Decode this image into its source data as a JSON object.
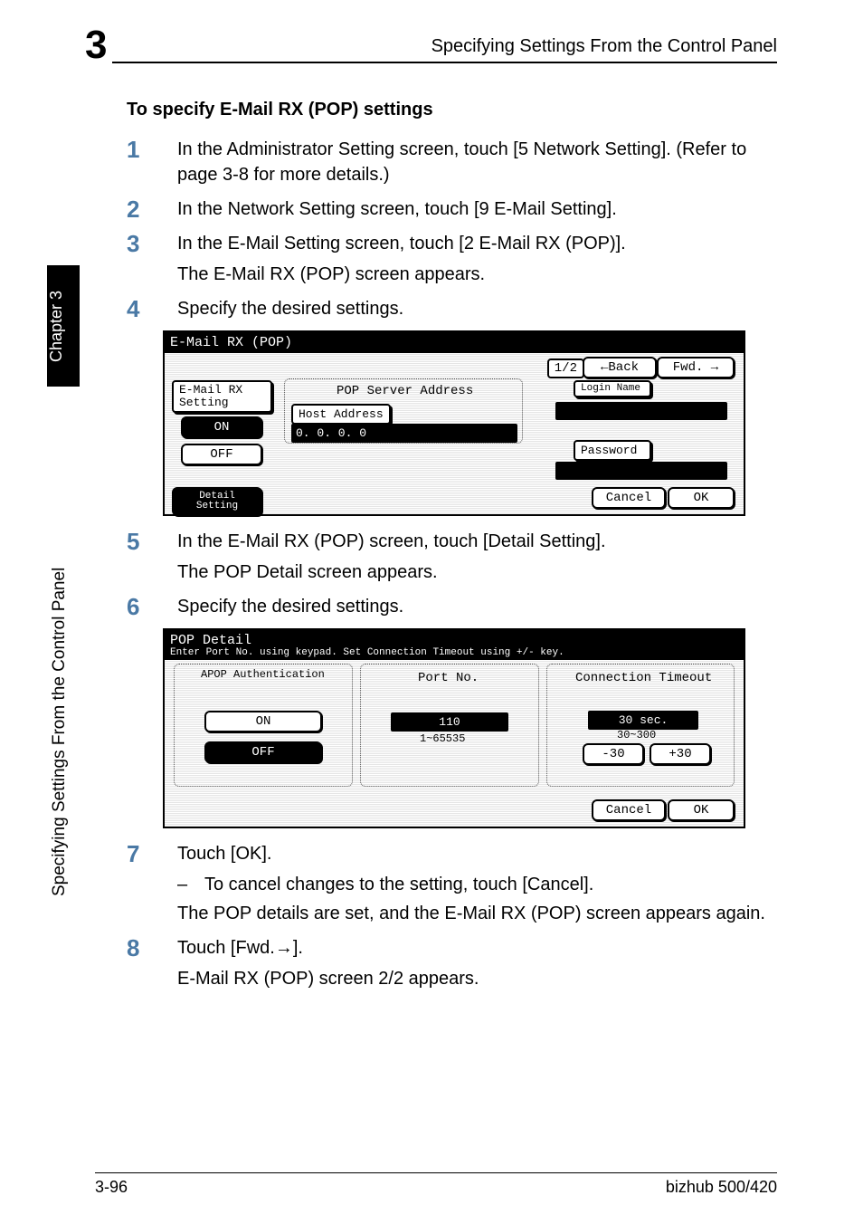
{
  "header": {
    "chapter_number": "3",
    "title": "Specifying Settings From the Control Panel"
  },
  "sidebar": {
    "chapter_label": "Chapter 3",
    "section_label": "Specifying Settings From the Control Panel"
  },
  "section_heading": "To specify E-Mail RX (POP) settings",
  "steps": {
    "s1": {
      "num": "1",
      "text": "In the Administrator Setting screen, touch [5 Network Setting]. (Refer to page 3-8 for more details.)"
    },
    "s2": {
      "num": "2",
      "text": "In the Network Setting screen, touch [9 E-Mail Setting]."
    },
    "s3": {
      "num": "3",
      "text": "In the E-Mail Setting screen, touch [2 E-Mail RX (POP)].",
      "sub": "The E-Mail RX (POP) screen appears."
    },
    "s4": {
      "num": "4",
      "text": "Specify the desired settings."
    },
    "s5": {
      "num": "5",
      "text": "In the E-Mail RX (POP) screen, touch [Detail Setting].",
      "sub": "The POP Detail screen appears."
    },
    "s6": {
      "num": "6",
      "text": "Specify the desired settings."
    },
    "s7": {
      "num": "7",
      "text": "Touch [OK].",
      "bullet": "To cancel changes to the setting, touch [Cancel].",
      "sub": "The POP details are set, and the E-Mail RX (POP) screen appears again."
    },
    "s8": {
      "num": "8",
      "text_prefix": "Touch [Fwd.",
      "arrow": "→",
      "text_suffix": "].",
      "sub": "E-Mail RX (POP) screen 2/2 appears."
    }
  },
  "screenshot1": {
    "title": "E-Mail RX (POP)",
    "page": "1/2",
    "back": "Back",
    "fwd": "Fwd.",
    "left_label": "E-Mail RX Setting",
    "on": "ON",
    "off": "OFF",
    "detail": "Detail Setting",
    "pop_server": "POP Server Address",
    "host_addr": "Host Address",
    "host_value": "0. 0. 0. 0",
    "login": "Login Name",
    "password": "Password",
    "cancel": "Cancel",
    "ok": "OK"
  },
  "screenshot2": {
    "title": "POP Detail",
    "instr": "Enter Port No. using keypad. Set Connection Timeout using +/- key.",
    "col1": "APOP Authentication",
    "on": "ON",
    "off": "OFF",
    "col2": "Port No.",
    "port_val": "110",
    "port_range": "1~65535",
    "col3": "Connection Timeout",
    "timeout_val": "30 sec.",
    "timeout_range": "30~300",
    "minus": "-30",
    "plus": "+30",
    "cancel": "Cancel",
    "ok": "OK"
  },
  "footer": {
    "left": "3-96",
    "right": "bizhub 500/420"
  }
}
